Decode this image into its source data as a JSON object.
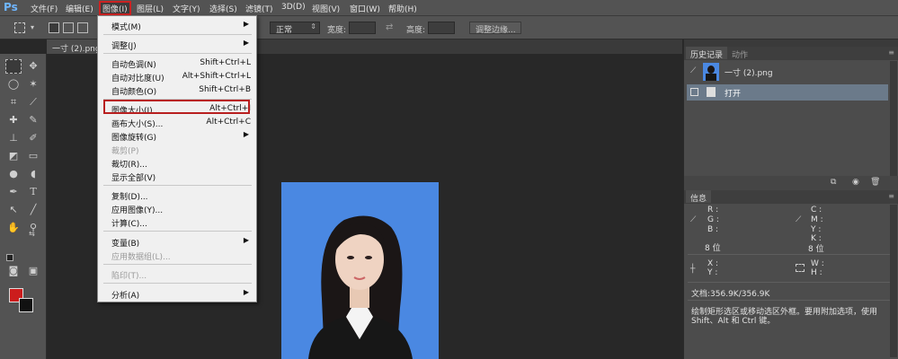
{
  "app": {
    "logo": "Ps"
  },
  "menubar": {
    "items": [
      {
        "label": "文件(F)"
      },
      {
        "label": "编辑(E)"
      },
      {
        "label": "图像(I)"
      },
      {
        "label": "图层(L)"
      },
      {
        "label": "文字(Y)"
      },
      {
        "label": "选择(S)"
      },
      {
        "label": "滤镜(T)"
      },
      {
        "label": "3D(D)"
      },
      {
        "label": "视图(V)"
      },
      {
        "label": "窗口(W)"
      },
      {
        "label": "帮助(H)"
      }
    ]
  },
  "options_bar": {
    "style_value": "正常",
    "width_label": "宽度:",
    "height_label": "高度:",
    "adjust_edge_button": "调整边缘..."
  },
  "document": {
    "tab_label": "一寸 (2).png"
  },
  "image_menu": {
    "items": [
      {
        "label": "模式(M)",
        "shortcut": "",
        "submenu": true,
        "disabled": false
      },
      {
        "label": "调整(J)",
        "shortcut": "",
        "submenu": true,
        "disabled": false
      },
      {
        "label": "自动色调(N)",
        "shortcut": "Shift+Ctrl+L",
        "submenu": false,
        "disabled": false
      },
      {
        "label": "自动对比度(U)",
        "shortcut": "Alt+Shift+Ctrl+L",
        "submenu": false,
        "disabled": false
      },
      {
        "label": "自动颜色(O)",
        "shortcut": "Shift+Ctrl+B",
        "submenu": false,
        "disabled": false
      },
      {
        "label": "图像大小(I)...",
        "shortcut": "Alt+Ctrl+I",
        "submenu": false,
        "disabled": false
      },
      {
        "label": "画布大小(S)...",
        "shortcut": "Alt+Ctrl+C",
        "submenu": false,
        "disabled": false
      },
      {
        "label": "图像旋转(G)",
        "shortcut": "",
        "submenu": true,
        "disabled": false
      },
      {
        "label": "裁剪(P)",
        "shortcut": "",
        "submenu": false,
        "disabled": true
      },
      {
        "label": "裁切(R)...",
        "shortcut": "",
        "submenu": false,
        "disabled": false
      },
      {
        "label": "显示全部(V)",
        "shortcut": "",
        "submenu": false,
        "disabled": false
      },
      {
        "label": "复制(D)...",
        "shortcut": "",
        "submenu": false,
        "disabled": false
      },
      {
        "label": "应用图像(Y)...",
        "shortcut": "",
        "submenu": false,
        "disabled": false
      },
      {
        "label": "计算(C)...",
        "shortcut": "",
        "submenu": false,
        "disabled": false
      },
      {
        "label": "变量(B)",
        "shortcut": "",
        "submenu": true,
        "disabled": false
      },
      {
        "label": "应用数据组(L)...",
        "shortcut": "",
        "submenu": false,
        "disabled": true
      },
      {
        "label": "陷印(T)...",
        "shortcut": "",
        "submenu": false,
        "disabled": true
      },
      {
        "label": "分析(A)",
        "shortcut": "",
        "submenu": true,
        "disabled": false
      }
    ]
  },
  "history_panel": {
    "tabs": [
      "历史记录",
      "动作"
    ],
    "snapshot_label": "一寸 (2).png",
    "steps": [
      "打开"
    ]
  },
  "info_panel": {
    "tab": "信息",
    "rgb_labels": [
      "R :",
      "G :",
      "B :"
    ],
    "cmyk_labels": [
      "C :",
      "M :",
      "Y :",
      "K :"
    ],
    "bit_depth_left": "8 位",
    "bit_depth_right": "8 位",
    "xy_labels": [
      "X :",
      "Y :"
    ],
    "wh_labels": [
      "W :",
      "H :"
    ],
    "doc_size": "文档:356.9K/356.9K",
    "hint_line1": "绘制矩形选区或移动选区外框。要用附加选项，使用",
    "hint_line2": "Shift、Alt 和 Ctrl 键。"
  },
  "colors": {
    "foreground": "#cc1d1d",
    "background": "#111111",
    "photo_background": "#4a88e2",
    "highlight_border": "#b81f1f"
  }
}
